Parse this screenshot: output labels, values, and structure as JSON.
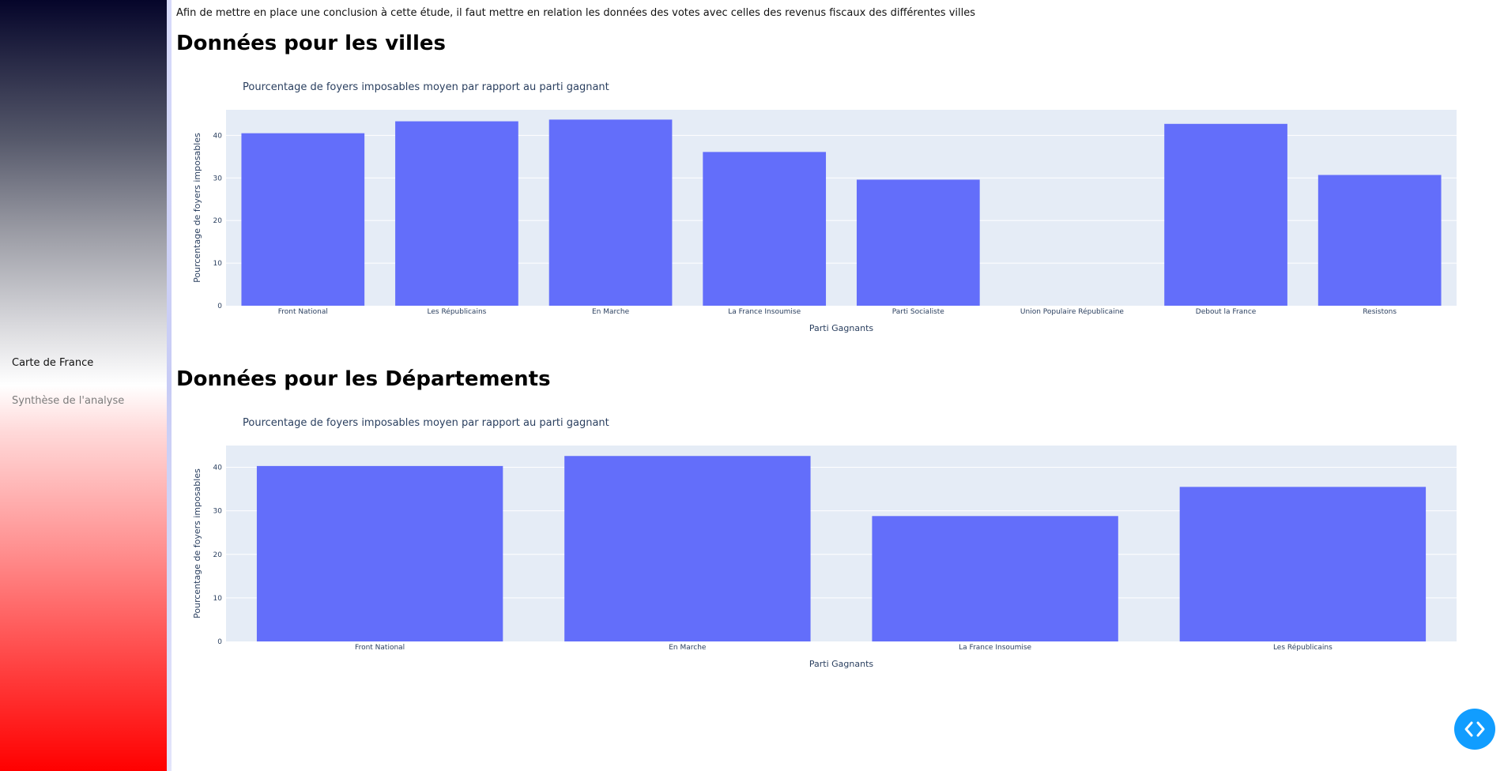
{
  "sidebar": {
    "items": [
      {
        "label": "Carte de France"
      },
      {
        "label": "Synthèse de l'analyse"
      }
    ]
  },
  "main": {
    "intro": "Afin de mettre en place une conclusion à cette étude, il faut mettre en relation les données des votes avec celles des revenus fiscaux des différentes villes",
    "sections": [
      {
        "title": "Données pour les villes"
      },
      {
        "title": "Données pour les Départements"
      }
    ]
  },
  "colors": {
    "bar": "#636efa",
    "plot_bg": "#e5ecf6",
    "text": "#2a3f5f",
    "nav_button": "#119dff"
  },
  "icons": {
    "nav_button": "code-brackets-icon"
  },
  "chart_data": [
    {
      "type": "bar",
      "title": "Pourcentage de foyers imposables moyen par rapport au parti gagnant",
      "xlabel": "Parti Gagnants",
      "ylabel": "Pourcentage de foyers imposables",
      "categories": [
        "Front National",
        "Les Républicains",
        "En Marche",
        "La France Insoumise",
        "Parti Socialiste",
        "Union Populaire Républicaine",
        "Debout la France",
        "Resistons"
      ],
      "values": [
        40.5,
        43.3,
        43.7,
        36.1,
        29.6,
        0,
        42.7,
        30.7
      ],
      "yticks": [
        0,
        10,
        20,
        30,
        40
      ],
      "ylim": [
        0,
        46
      ],
      "grid": true,
      "legend": false
    },
    {
      "type": "bar",
      "title": "Pourcentage de foyers imposables moyen par rapport au parti gagnant",
      "xlabel": "Parti Gagnants",
      "ylabel": "Pourcentage de foyers imposables",
      "categories": [
        "Front National",
        "En Marche",
        "La France Insoumise",
        "Les Républicains"
      ],
      "values": [
        40.3,
        42.6,
        28.8,
        35.5
      ],
      "yticks": [
        0,
        10,
        20,
        30,
        40
      ],
      "ylim": [
        0,
        45
      ],
      "grid": true,
      "legend": false
    }
  ]
}
